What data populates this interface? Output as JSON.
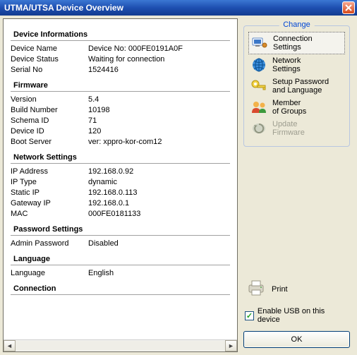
{
  "window": {
    "title": "UTMA/UTSA Device Overview"
  },
  "sections": {
    "device_info_title": "Device Informations",
    "device_name_k": "Device Name",
    "device_name_v": "Device No: 000FE0191A0F",
    "device_status_k": "Device Status",
    "device_status_v": "Waiting for connection",
    "serial_no_k": "Serial No",
    "serial_no_v": "1524416",
    "firmware_title": "Firmware",
    "version_k": "Version",
    "version_v": "5.4",
    "build_k": "Build Number",
    "build_v": "10198",
    "schema_k": "Schema ID",
    "schema_v": "71",
    "deviceid_k": "Device ID",
    "deviceid_v": "120",
    "boot_k": "Boot Server",
    "boot_v": "ver: xppro-kor-com12",
    "network_title": "Network Settings",
    "ip_k": "IP Address",
    "ip_v": "192.168.0.92",
    "iptype_k": "IP Type",
    "iptype_v": "dynamic",
    "static_k": "Static IP",
    "static_v": "192.168.0.113",
    "gateway_k": "Gateway IP",
    "gateway_v": "192.168.0.1",
    "mac_k": "MAC",
    "mac_v": "000FE0181133",
    "password_title": "Password Settings",
    "admin_k": "Admin Password",
    "admin_v": "Disabled",
    "language_title": "Language",
    "lang_k": "Language",
    "lang_v": "English",
    "connection_title": "Connection"
  },
  "change": {
    "legend": "Change",
    "conn": "Connection\nSettings",
    "net": "Network\nSettings",
    "pwd": "Setup Password\nand Language",
    "groups": "Member\nof Groups",
    "update": "Update\nFirmware"
  },
  "print_label": "Print",
  "usb_label": "Enable USB on this device",
  "ok_label": "OK"
}
